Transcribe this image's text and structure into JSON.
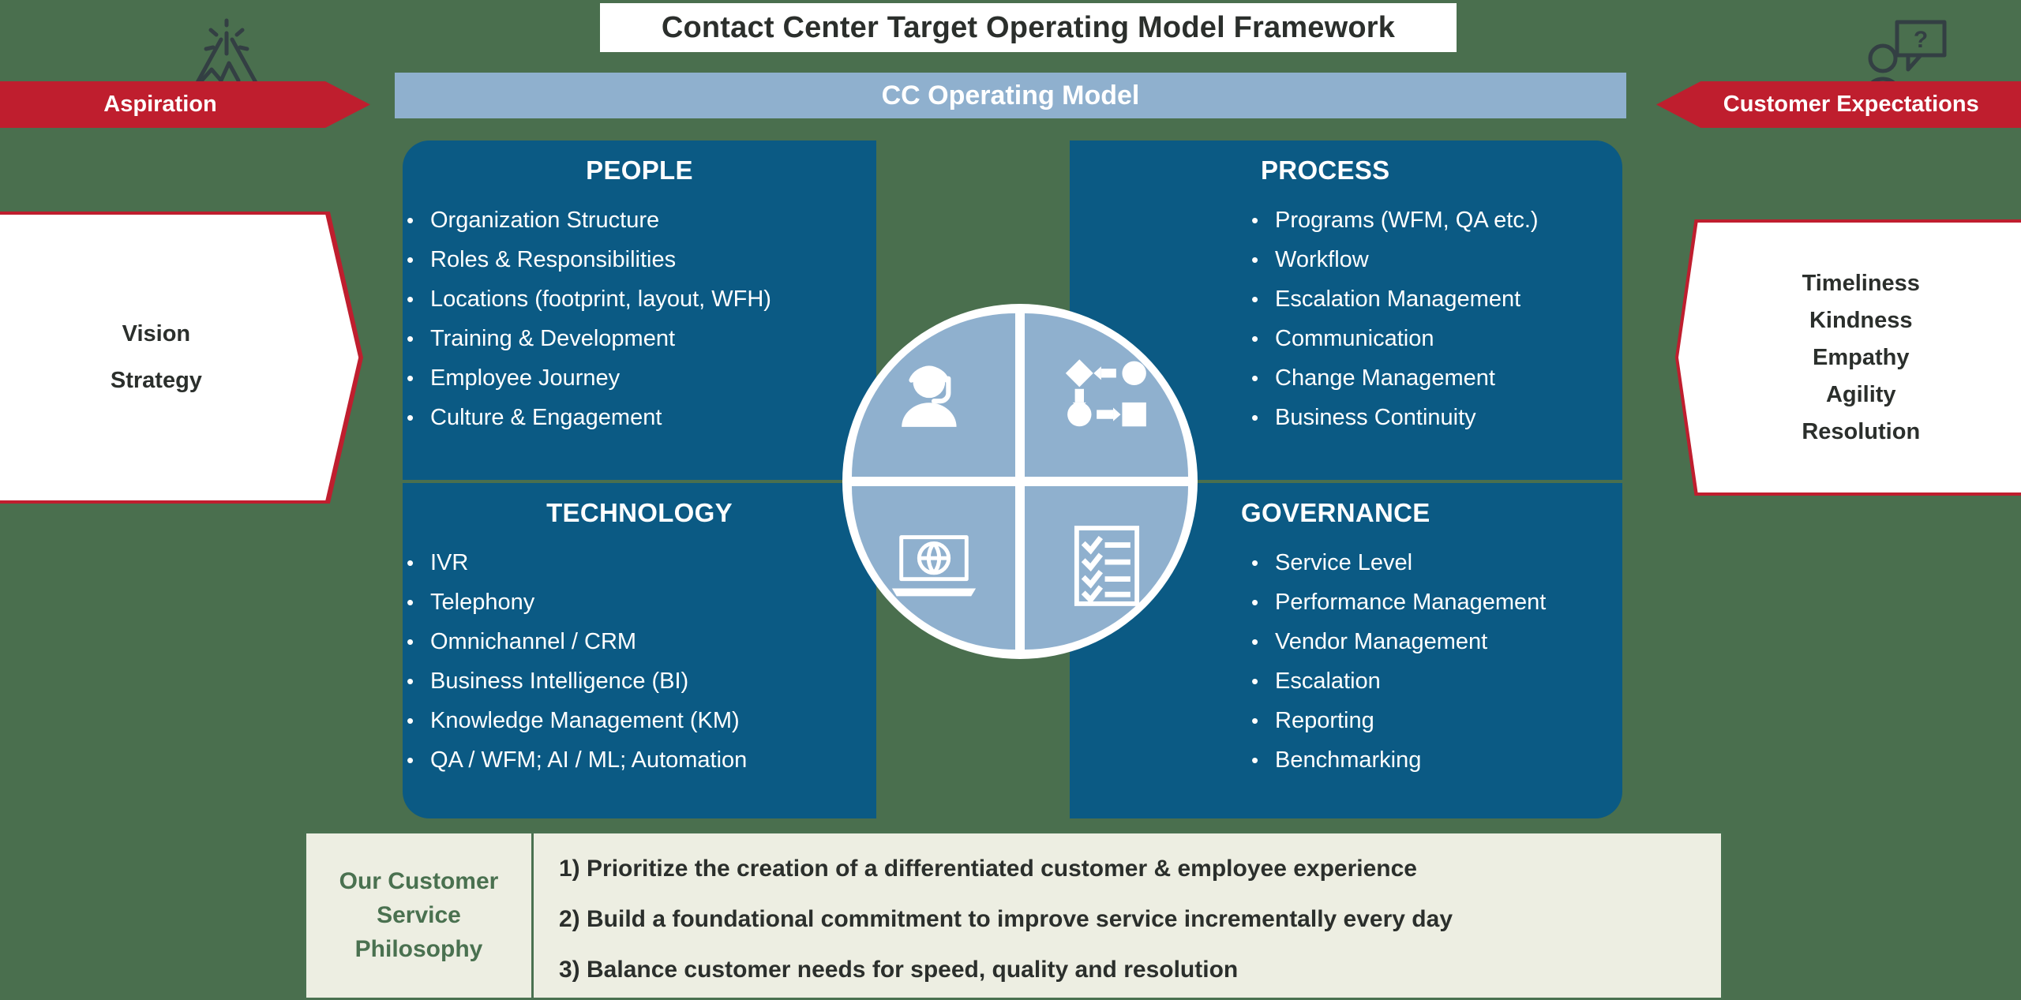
{
  "title": "Contact Center Target Operating Model Framework",
  "banner": {
    "label": "CC Operating Model"
  },
  "left": {
    "icon": "mountain-summit-icon",
    "chevron_label": "Aspiration",
    "vision_lines": [
      "Vision",
      "Strategy"
    ]
  },
  "right": {
    "icon": "person-question-bubble-icon",
    "chevron_label": "Customer Expectations",
    "expectations": [
      "Timeliness",
      "Kindness",
      "Empathy",
      "Agility",
      "Resolution"
    ]
  },
  "quadrants": [
    {
      "id": "people",
      "title": "PEOPLE",
      "items": [
        "Organization Structure",
        "Roles & Responsibilities",
        "Locations (footprint, layout, WFH)",
        "Training & Development",
        "Employee Journey",
        "Culture & Engagement"
      ]
    },
    {
      "id": "process",
      "title": "PROCESS",
      "items": [
        "Programs (WFM, QA etc.)",
        "Workflow",
        "Escalation Management",
        "Communication",
        "Change Management",
        "Business Continuity"
      ]
    },
    {
      "id": "technology",
      "title": "TECHNOLOGY",
      "items": [
        "IVR",
        "Telephony",
        "Omnichannel / CRM",
        "Business Intelligence (BI)",
        "Knowledge Management (KM)",
        "QA / WFM; AI / ML; Automation"
      ]
    },
    {
      "id": "governance",
      "title": "GOVERNANCE",
      "items": [
        "Service Level",
        "Performance Management",
        "Vendor Management",
        "Escalation",
        "Reporting",
        "Benchmarking"
      ]
    }
  ],
  "center": {
    "icons": [
      "headset-agent-icon",
      "flowchart-process-icon",
      "laptop-globe-icon",
      "checklist-clipboard-icon"
    ]
  },
  "philosophy": {
    "heading_lines": [
      "Our Customer",
      "Service",
      "Philosophy"
    ],
    "points": [
      "1) Prioritize the creation of a differentiated customer & employee experience",
      "2) Build a foundational commitment to improve service incrementally every day",
      "3) Balance customer needs for speed, quality and resolution"
    ]
  },
  "colors": {
    "background_green": "#4a6f4e",
    "quadrant_blue": "#0b5a84",
    "banner_blue": "#8fb0ce",
    "accent_red": "#bf1e2e",
    "philosophy_bg": "#edeee2",
    "philosophy_green": "#4a7150"
  }
}
